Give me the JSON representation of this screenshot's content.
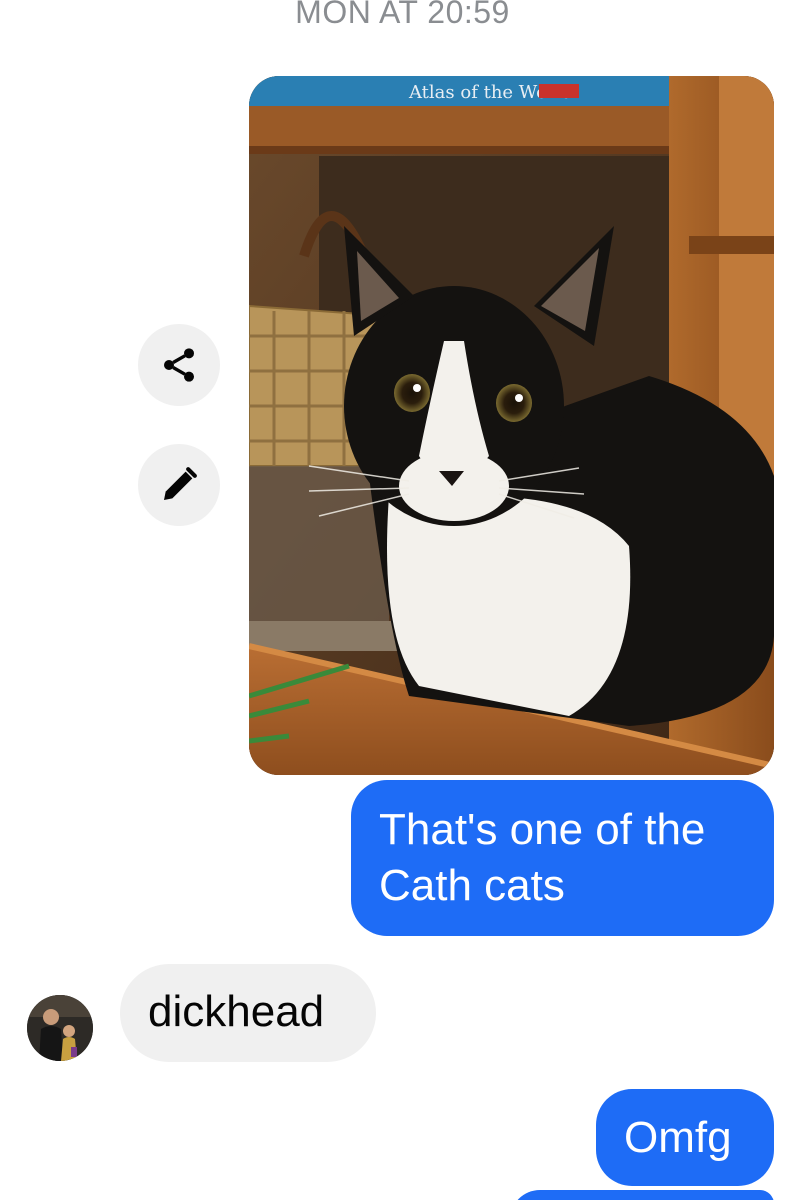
{
  "chat": {
    "timestamp": "MON AT 20:59",
    "photo": {
      "subject": "black-and-white cat",
      "book_spine_text": "Atlas of the World"
    },
    "actions": {
      "share_icon": "share-icon",
      "edit_icon": "pencil-icon"
    },
    "messages": [
      {
        "direction": "outgoing",
        "text": "That's one of the Cath cats"
      },
      {
        "direction": "incoming",
        "text": "dickhead"
      },
      {
        "direction": "outgoing",
        "text": "Omfg"
      }
    ]
  },
  "colors": {
    "outgoing_bubble": "#1e6cf6",
    "incoming_bubble": "#f0f0f0",
    "timestamp_text": "#8a8d91",
    "action_button_bg": "#f0f0f0"
  }
}
